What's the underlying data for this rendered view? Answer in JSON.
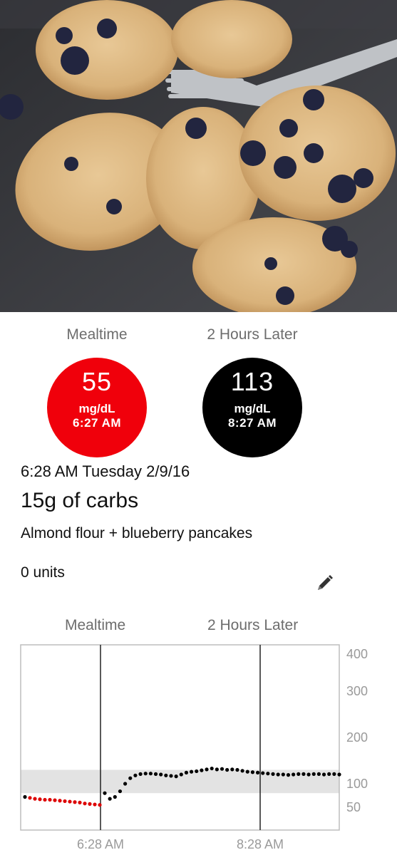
{
  "photo": {
    "icon": "food-photo"
  },
  "readings": {
    "mealtime": {
      "label": "Mealtime",
      "value": "55",
      "unit": "mg/dL",
      "time": "6:27 AM",
      "color": "#f0000b"
    },
    "later": {
      "label": "2 Hours Later",
      "value": "113",
      "unit": "mg/dL",
      "time": "8:27 AM",
      "color": "#000000"
    }
  },
  "entry": {
    "datetime": "6:28 AM Tuesday 2/9/16",
    "carbs": "15g of carbs",
    "description": "Almond flour + blueberry pancakes",
    "units": "0 units",
    "edit_icon": "pencil-icon"
  },
  "chart_header": {
    "meal_label": "Mealtime",
    "later_label": "2 Hours Later"
  },
  "chart_data": {
    "type": "scatter",
    "x_ticks": [
      "6:28 AM",
      "8:28 AM"
    ],
    "y_ticks": [
      "400",
      "300",
      "200",
      "100",
      "50"
    ],
    "target_range": [
      80,
      130
    ],
    "vlines": [
      "6:28 AM",
      "8:28 AM"
    ],
    "red_color": "#dd0000",
    "black_color": "#000000",
    "red_points": [
      72,
      70,
      68,
      67,
      66,
      66,
      65,
      64,
      63,
      62,
      61,
      60,
      58,
      57,
      56,
      55
    ],
    "black_points": [
      80,
      68,
      72,
      84,
      100,
      112,
      118,
      121,
      122,
      122,
      121,
      120,
      118,
      117,
      116,
      120,
      124,
      126,
      127,
      129,
      131,
      133,
      131,
      132,
      130,
      131,
      130,
      128,
      126,
      125,
      124,
      123,
      122,
      121,
      120,
      120,
      119,
      120,
      121,
      121,
      120,
      121,
      121,
      120,
      121,
      121,
      120
    ]
  }
}
